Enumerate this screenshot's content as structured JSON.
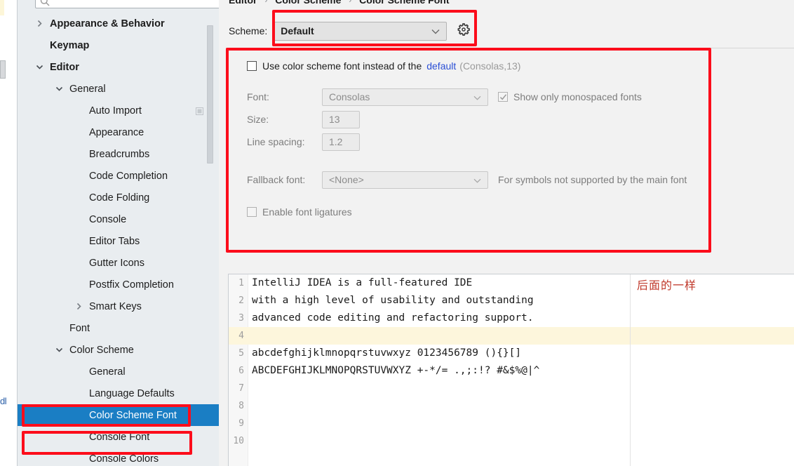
{
  "window": {
    "left_fragment_text": "dl"
  },
  "search": {
    "placeholder": "",
    "value": "",
    "icon": "search-icon"
  },
  "sidebar": {
    "scrollbar": {
      "name": "sidebar-scrollbar"
    },
    "items": [
      {
        "label": "Appearance & Behavior",
        "indent": 0,
        "arrow": "right",
        "bold": true,
        "selected": false,
        "badge": false
      },
      {
        "label": "Keymap",
        "indent": 0,
        "arrow": "none",
        "bold": true,
        "selected": false,
        "badge": false
      },
      {
        "label": "Editor",
        "indent": 0,
        "arrow": "down",
        "bold": true,
        "selected": false,
        "badge": false
      },
      {
        "label": "General",
        "indent": 1,
        "arrow": "down",
        "bold": false,
        "selected": false,
        "badge": false
      },
      {
        "label": "Auto Import",
        "indent": 2,
        "arrow": "none",
        "bold": false,
        "selected": false,
        "badge": true
      },
      {
        "label": "Appearance",
        "indent": 2,
        "arrow": "none",
        "bold": false,
        "selected": false,
        "badge": false
      },
      {
        "label": "Breadcrumbs",
        "indent": 2,
        "arrow": "none",
        "bold": false,
        "selected": false,
        "badge": false
      },
      {
        "label": "Code Completion",
        "indent": 2,
        "arrow": "none",
        "bold": false,
        "selected": false,
        "badge": false
      },
      {
        "label": "Code Folding",
        "indent": 2,
        "arrow": "none",
        "bold": false,
        "selected": false,
        "badge": false
      },
      {
        "label": "Console",
        "indent": 2,
        "arrow": "none",
        "bold": false,
        "selected": false,
        "badge": false
      },
      {
        "label": "Editor Tabs",
        "indent": 2,
        "arrow": "none",
        "bold": false,
        "selected": false,
        "badge": false
      },
      {
        "label": "Gutter Icons",
        "indent": 2,
        "arrow": "none",
        "bold": false,
        "selected": false,
        "badge": false
      },
      {
        "label": "Postfix Completion",
        "indent": 2,
        "arrow": "none",
        "bold": false,
        "selected": false,
        "badge": false
      },
      {
        "label": "Smart Keys",
        "indent": 2,
        "arrow": "right",
        "bold": false,
        "selected": false,
        "badge": false
      },
      {
        "label": "Font",
        "indent": 1,
        "arrow": "none",
        "bold": false,
        "selected": false,
        "badge": false
      },
      {
        "label": "Color Scheme",
        "indent": 1,
        "arrow": "down",
        "bold": false,
        "selected": false,
        "badge": false
      },
      {
        "label": "General",
        "indent": 2,
        "arrow": "none",
        "bold": false,
        "selected": false,
        "badge": false
      },
      {
        "label": "Language Defaults",
        "indent": 2,
        "arrow": "none",
        "bold": false,
        "selected": false,
        "badge": false
      },
      {
        "label": "Color Scheme Font",
        "indent": 2,
        "arrow": "none",
        "bold": false,
        "selected": true,
        "badge": false
      },
      {
        "label": "Console Font",
        "indent": 2,
        "arrow": "none",
        "bold": false,
        "selected": false,
        "badge": false
      },
      {
        "label": "Console Colors",
        "indent": 2,
        "arrow": "none",
        "bold": false,
        "selected": false,
        "badge": false
      }
    ]
  },
  "breadcrumb": {
    "part1": "Editor",
    "sep1": "›",
    "part2": "Color Scheme",
    "sep2": "›",
    "part3": "Color Scheme Font"
  },
  "scheme": {
    "label": "Scheme:",
    "value": "Default",
    "gear_icon": "gear-icon",
    "chevron_icon": "chevron-down-icon"
  },
  "font_settings": {
    "use_scheme_font_label": "Use color scheme font instead of the",
    "use_scheme_font_checked": false,
    "default_link": "default",
    "default_detail": "(Consolas,13)",
    "font_label": "Font:",
    "font_value": "Consolas",
    "monospaced_label": "Show only monospaced fonts",
    "monospaced_checked": true,
    "size_label": "Size:",
    "size_value": "13",
    "line_spacing_label": "Line spacing:",
    "line_spacing_value": "1.2",
    "fallback_label": "Fallback font:",
    "fallback_value": "<None>",
    "fallback_hint": "For symbols not supported by the main font",
    "ligatures_label": "Enable font ligatures",
    "ligatures_checked": false
  },
  "preview": {
    "lines": [
      {
        "no": "1",
        "text": "IntelliJ IDEA is a full-featured IDE",
        "caret": false
      },
      {
        "no": "2",
        "text": "with a high level of usability and outstanding",
        "caret": false
      },
      {
        "no": "3",
        "text": "advanced code editing and refactoring support.",
        "caret": false
      },
      {
        "no": "4",
        "text": "",
        "caret": true
      },
      {
        "no": "5",
        "text": "abcdefghijklmnopqrstuvwxyz 0123456789 (){}[]",
        "caret": false
      },
      {
        "no": "6",
        "text": "ABCDEFGHIJKLMNOPQRSTUVWXYZ +-*/= .,;:!? #&$%@|^",
        "caret": false
      },
      {
        "no": "7",
        "text": "",
        "caret": false
      },
      {
        "no": "8",
        "text": "",
        "caret": false
      },
      {
        "no": "9",
        "text": "",
        "caret": false
      },
      {
        "no": "10",
        "text": "",
        "caret": false
      }
    ],
    "annotation_note": "后面的一样"
  },
  "colors": {
    "selection_blue": "#1a7ec4",
    "annotation_red": "#fc0d1b",
    "link_blue": "#2b4fd6",
    "caret_row": "#fdf6dc",
    "sidebar_bg": "#e9edf0",
    "note_red": "#c0392b"
  }
}
